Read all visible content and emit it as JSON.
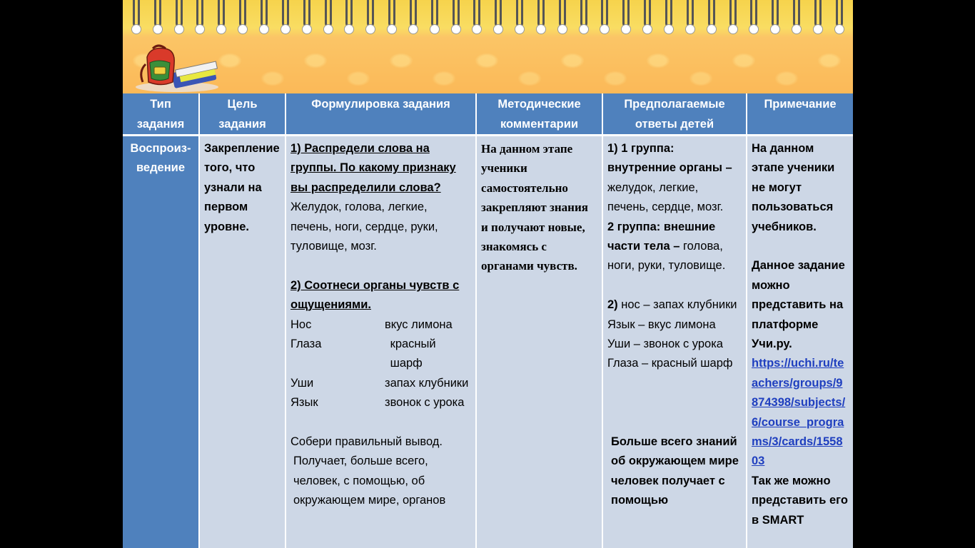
{
  "columns": [
    "Тип задания",
    "Цель задания",
    "Формулировка задания",
    "Методические комментарии",
    "Предполагаемые ответы детей",
    "Примечание"
  ],
  "row": {
    "type": "Воспроиз-ведение",
    "goal": "Закрепление того, что узнали на первом уровне.",
    "task": {
      "q1_title": "1) Распредели слова на группы. По какому признаку вы распределили слова?",
      "q1_words": "Желудок, голова, легкие, печень, ноги, сердце, руки, туловище, мозг.",
      "q2_title": "2) Соотнеси органы чувств с ощущениями.",
      "pairs": [
        {
          "left": "Нос",
          "right": "вкус лимона"
        },
        {
          "left": "Глаза",
          "right": "красный шарф"
        },
        {
          "left": "Уши",
          "right": "запах клубники"
        },
        {
          "left": "Язык",
          "right": "звонок с урока"
        }
      ],
      "conclusion_title": "Собери правильный вывод.",
      "conclusion_text": "Получает, больше всего, человек, с помощью, об окружающем мире, органов"
    },
    "comments": "На данном этапе ученики самостоятельно закрепляют знания и получают новые, знакомясь с органами чувств.",
    "answers": {
      "a1_head": "1) 1 группа: внутренние органы –",
      "a1_text": "желудок, легкие, печень, сердце, мозг.",
      "a2_head": "2 группа: внешние части тела –",
      "a2_text": "голова, ноги, руки, туловище.",
      "b_head": "2)",
      "b_lines": [
        "нос – запах клубники",
        "Язык – вкус лимона",
        "Уши – звонок с урока",
        "Глаза – красный шарф"
      ],
      "conclusion": "Больше всего знаний об окружающем мире человек получает с помощью"
    },
    "note": {
      "text1": "На данном этапе ученики не могут пользоваться учебников.",
      "text2": "Данное задание можно представить на платформе Учи.ру.",
      "link": "https://uchi.ru/teachers/groups/9874398/subjects/6/course_programs/3/cards/155803",
      "text3": "Так же можно представить его в SMART"
    }
  },
  "colors": {
    "header_bg": "#4f81bd",
    "body_bg": "#cdd7e6",
    "banner": "#f9c85a",
    "link": "#1f3fbf"
  }
}
